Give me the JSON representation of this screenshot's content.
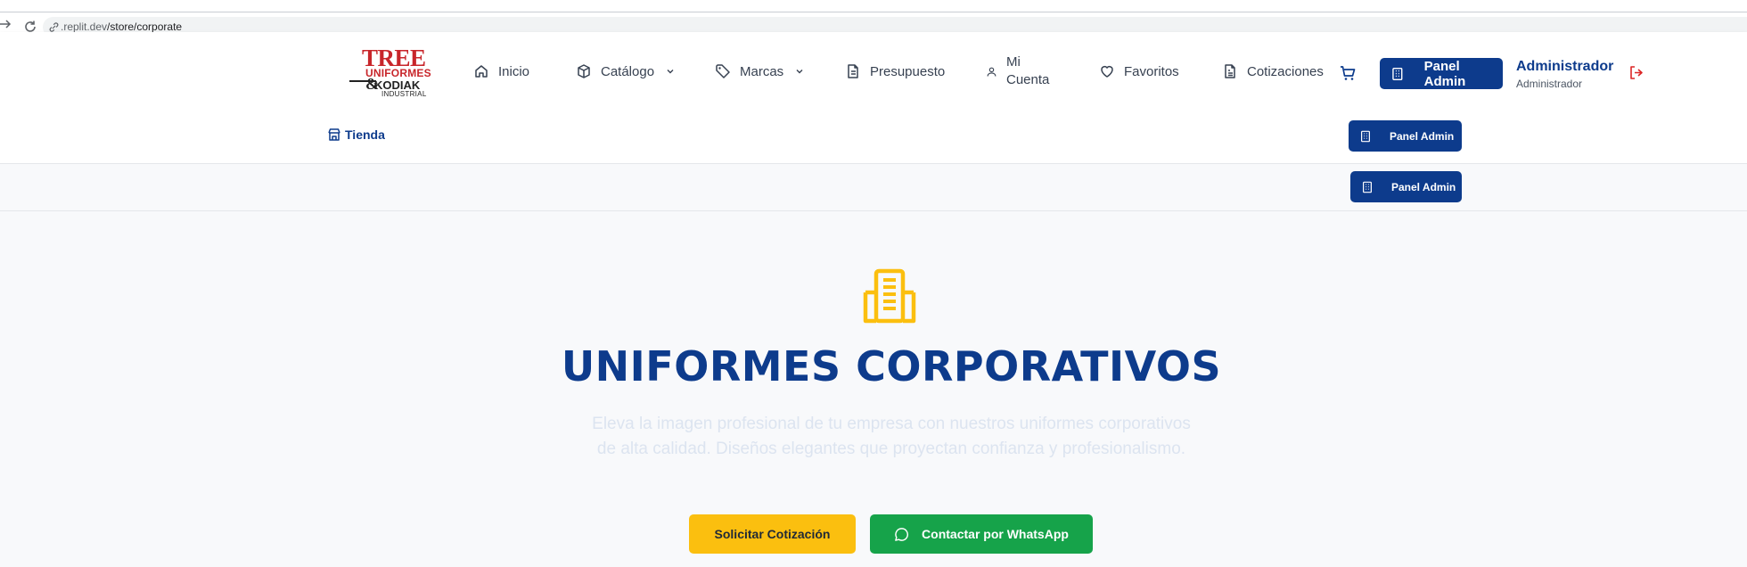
{
  "browser": {
    "url_dim": ".replit.dev",
    "url_path": "/store/corporate"
  },
  "header": {
    "logo": {
      "line1": "TREE",
      "line2": "UNIFORMES",
      "amp": "&",
      "line3": "KODIAK",
      "line4": "INDUSTRIAL"
    },
    "nav": [
      {
        "label": "Inicio",
        "icon": "home-icon"
      },
      {
        "label": "Catálogo",
        "icon": "box-icon",
        "dropdown": true
      },
      {
        "label": "Marcas",
        "icon": "tag-icon",
        "dropdown": true
      },
      {
        "label": "Presupuesto",
        "icon": "document-icon"
      },
      {
        "label_line1": "Mi",
        "label_line2": "Cuenta",
        "icon": "user-icon"
      },
      {
        "label": "Favoritos",
        "icon": "heart-icon"
      },
      {
        "label": "Cotizaciones",
        "icon": "file-text-icon"
      }
    ],
    "admin_button": "Panel Admin",
    "user": {
      "name": "Administrador",
      "role": "Administrador"
    }
  },
  "subbar": {
    "store_link": "Tienda",
    "admin_button": "Panel Admin"
  },
  "bar2": {
    "admin_button": "Panel Admin"
  },
  "hero": {
    "title": "UNIFORMES CORPORATIVOS",
    "description": "Eleva la imagen profesional de tu empresa con nuestros uniformes corporativos de alta calidad. Diseños elegantes que proyectan confianza y profesionalismo.",
    "cta_quote": "Solicitar Cotización",
    "cta_whatsapp": "Contactar por WhatsApp"
  },
  "colors": {
    "brand_blue": "#0d3b8c",
    "accent_yellow": "#fbbf0f",
    "whatsapp_green": "#16a34a",
    "logo_red": "#c8262b",
    "logout_red": "#dc2626"
  }
}
